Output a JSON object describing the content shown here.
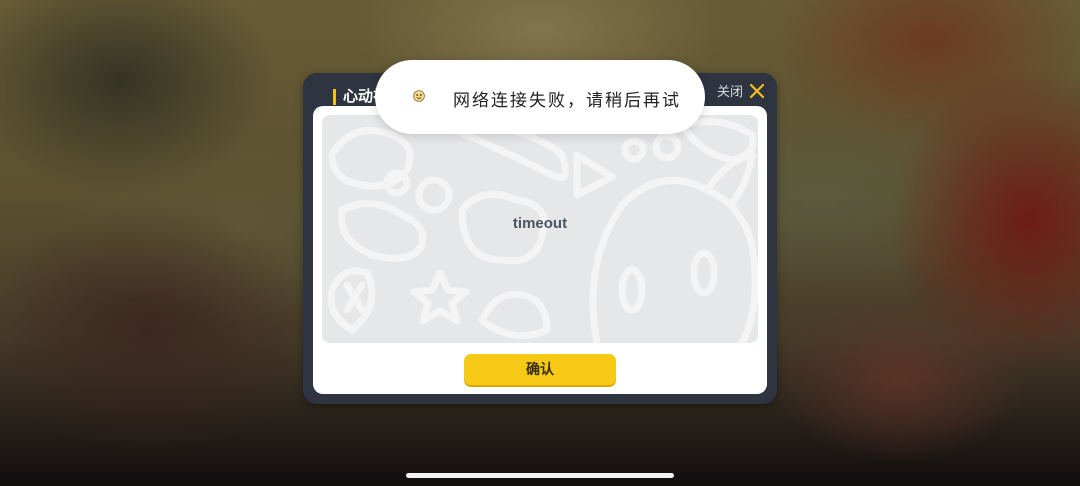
{
  "dialog": {
    "title": "心动礼",
    "close_label": "关闭",
    "message": "timeout",
    "confirm_label": "确认"
  },
  "toast": {
    "text": "网络连接失败，请稍后再试",
    "icon": "emoji-face-icon"
  },
  "colors": {
    "accent_yellow": "#f6c916",
    "dialog_frame": "#2f3540",
    "panel_bg": "#e6e7e8",
    "message_text": "#4c5663"
  }
}
